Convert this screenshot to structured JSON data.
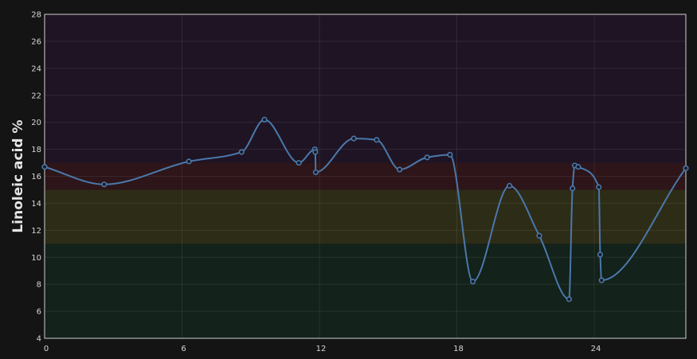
{
  "chart_data": {
    "type": "line",
    "title": "",
    "xlabel": "",
    "ylabel": "Linoleic acid %",
    "xlim": [
      0,
      28
    ],
    "ylim": [
      4,
      28
    ],
    "x_ticks": [
      0,
      6,
      12,
      18,
      24
    ],
    "y_ticks": [
      4,
      6,
      8,
      10,
      12,
      14,
      16,
      18,
      20,
      22,
      24,
      26,
      28
    ],
    "grid": true,
    "legend": "none",
    "bands": [
      {
        "from": 4,
        "to": 11,
        "color": "#13221a"
      },
      {
        "from": 11,
        "to": 15,
        "color": "#2d2c17"
      },
      {
        "from": 15,
        "to": 17,
        "color": "#2d1519"
      },
      {
        "from": 17,
        "to": 28,
        "color": "#1f1424"
      }
    ],
    "line_color": "#4a78ab",
    "series": [
      {
        "x": [
          0.0,
          2.6,
          6.3,
          8.6,
          9.6,
          11.1,
          11.8,
          11.82,
          11.84,
          13.5,
          14.5,
          15.5,
          16.7,
          17.7,
          18.7,
          20.3,
          21.6,
          22.9,
          23.05,
          23.15,
          23.3,
          24.2,
          24.26,
          24.32,
          28.0
        ],
        "y": [
          16.7,
          15.4,
          17.1,
          17.8,
          20.2,
          17.0,
          18.0,
          17.8,
          16.3,
          18.8,
          18.7,
          16.5,
          17.4,
          17.6,
          8.2,
          15.3,
          11.6,
          6.9,
          15.1,
          16.8,
          16.7,
          15.2,
          10.2,
          8.3,
          16.6
        ]
      }
    ]
  }
}
